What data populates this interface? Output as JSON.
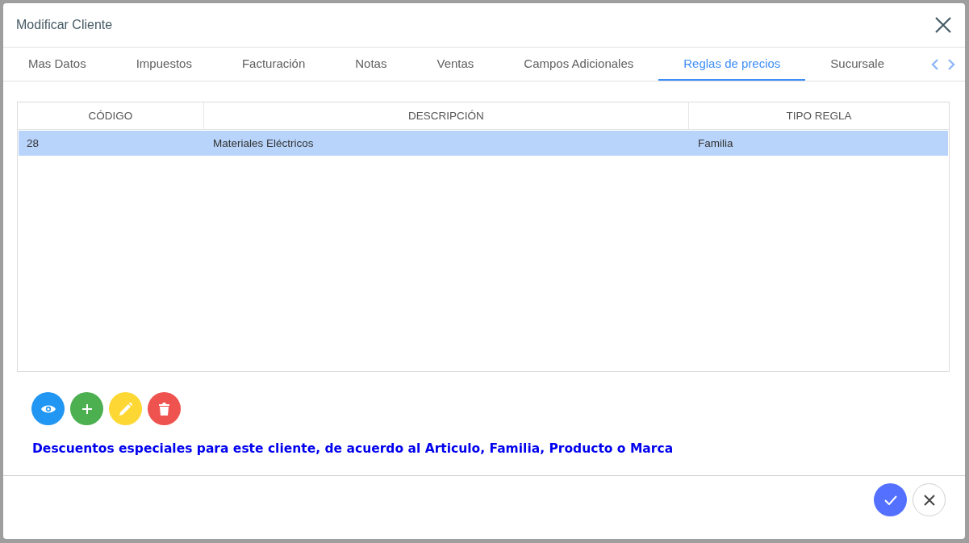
{
  "dialog": {
    "title": "Modificar Cliente"
  },
  "tabs": [
    {
      "label": "Mas Datos",
      "selected": false
    },
    {
      "label": "Impuestos",
      "selected": false
    },
    {
      "label": "Facturación",
      "selected": false
    },
    {
      "label": "Notas",
      "selected": false
    },
    {
      "label": "Ventas",
      "selected": false
    },
    {
      "label": "Campos Adicionales",
      "selected": false
    },
    {
      "label": "Reglas de precios",
      "selected": true
    },
    {
      "label": "Sucursale",
      "selected": false
    }
  ],
  "table": {
    "columns": [
      "CÓDIGO",
      "DESCRIPCIÓN",
      "TIPO REGLA"
    ],
    "rows": [
      {
        "cells": [
          "28",
          "Materiales Eléctricos",
          "Familia"
        ],
        "selected": true
      }
    ]
  },
  "actions": [
    {
      "kind": "view"
    },
    {
      "kind": "add"
    },
    {
      "kind": "edit"
    },
    {
      "kind": "delete"
    }
  ],
  "note": "Descuentos especiales para este cliente, de acuerdo al Articulo, Familia, Producto o Marca",
  "footer": [
    {
      "kind": "confirm"
    },
    {
      "kind": "cancel"
    }
  ]
}
